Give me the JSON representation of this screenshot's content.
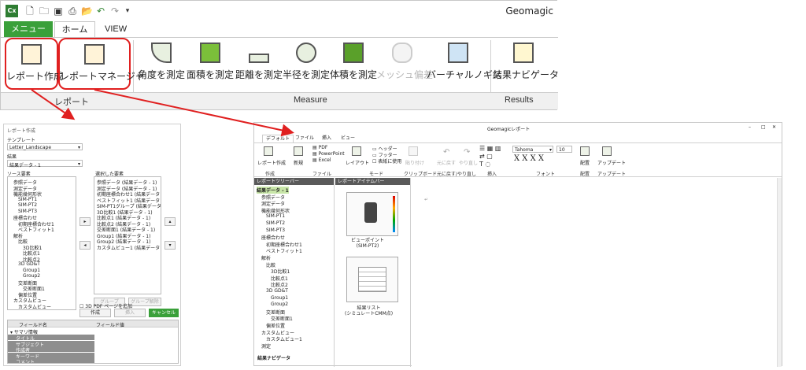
{
  "app": {
    "logo": "Cx",
    "title": "Geomagic",
    "quick_access_icons": [
      "new-icon",
      "open-icon",
      "save-icon",
      "print-icon",
      "folder-icon",
      "undo-icon",
      "redo-icon",
      "customize-icon"
    ]
  },
  "tabs": {
    "menu": "メニュー",
    "home": "ホーム",
    "view": "VIEW"
  },
  "ribbon": {
    "buttons": [
      {
        "label": "レポート作成",
        "icon": "report-create-icon"
      },
      {
        "label": "レポートマネージャ",
        "icon": "report-manager-icon"
      },
      {
        "label": "角度を測定",
        "icon": "angle-icon"
      },
      {
        "label": "面積を測定",
        "icon": "area-icon"
      },
      {
        "label": "距離を測定",
        "icon": "distance-icon"
      },
      {
        "label": "半径を測定",
        "icon": "radius-icon"
      },
      {
        "label": "体積を測定",
        "icon": "volume-icon"
      },
      {
        "label": "メッシュ偏差",
        "icon": "mesh-deviation-icon"
      },
      {
        "label": "バーチャルノギス",
        "icon": "caliper-icon"
      },
      {
        "label": "結果ナビゲータ",
        "icon": "result-navigator-icon"
      }
    ],
    "groups": {
      "report": "レポート",
      "measure": "Measure",
      "results": "Results"
    }
  },
  "left_panel": {
    "title": "レポート作成",
    "template_label": "テンプレート",
    "template_value": "Letter_Landscape",
    "result_label": "結果",
    "result_value": "結果データ - 1",
    "source_label": "ソース要素",
    "selected_label": "選択した要素",
    "source_items": [
      "参照データ",
      "測定データ",
      "機能幾何形状",
      "SIM-PT1",
      "SIM-PT2",
      "SIM-PT3",
      "座標合わせ",
      "初期座標合わせ1",
      "ベストフィット1",
      "解析",
      "比較",
      "3D比較1",
      "比較点1",
      "比較点2",
      "3D GD&T",
      "Group1",
      "Group2",
      "交差断面",
      "交差断面1",
      "偏差位置",
      "カスタムビュー",
      "カスタムビュー"
    ],
    "selected_items": [
      "参照データ (結果データ - 1)",
      "測定データ (結果データ - 1)",
      "初期座標合わせ1 (結果データ - 1)",
      "ベストフィット1 (結果データ - 1)",
      "SIM-PT1グループ (結果データ - 1)",
      "3D比較1 (結果データ - 1)",
      "比較点1 (結果データ - 1)",
      "比較点2 (結果データ - 1)",
      "交差断面1 (結果データ - 1)",
      "Group1 (結果データ - 1)",
      "Group2 (結果データ - 1)",
      "カスタムビュー1 (結果データ - 1)"
    ],
    "group_btn": "グループ",
    "ungroup_btn": "グループ解除",
    "pdf_check": "3D PDF ページを追加",
    "create_btn": "作成",
    "insert_btn": "挿入",
    "cancel_btn": "キャンセル",
    "field_name": "フィールド名",
    "field_value": "フィールド値",
    "sample_info": "サマリ情報",
    "fields": [
      "タイトル",
      "サブジェクト",
      "作成者",
      "キーワード",
      "コメント"
    ]
  },
  "report_window": {
    "title": "Geomagicレポート",
    "window_controls": [
      "–",
      "□",
      "✕"
    ],
    "tabs": [
      "デフォルト",
      "ファイル",
      "挿入",
      "ビュー"
    ],
    "buttons": {
      "create": "レポート作成",
      "new": "新規",
      "pdf": "PDF",
      "ppt": "PowerPoint",
      "excel": "Excel",
      "layout": "レイアウト",
      "header": "ヘッダー",
      "footer": "フッター",
      "table_use": "表紙に使用",
      "paste": "貼り付け",
      "undo": "元に戻す",
      "redo": "やり直し",
      "place": "配置",
      "update": "アップデート"
    },
    "font_name": "Tahoma",
    "font_size": "10",
    "font_styles": "X X X X",
    "groups": [
      "作成",
      "ファイル",
      "モード",
      "クリップボード",
      "元に戻す/やり直し",
      "挿入",
      "フォント",
      "配置",
      "アップデート"
    ],
    "tree_header": "レポートツリーバー",
    "items_header": "レポートアイテムバー",
    "tree_items": [
      "結果データ - 1",
      "参照データ",
      "測定データ",
      "機能幾何形状",
      "SIM-PT1",
      "SIM-PT2",
      "SIM-PT3",
      "座標合わせ",
      "初期座標合わせ1",
      "ベストフィット1",
      "解析",
      "比較",
      "3D比較1",
      "比較点1",
      "比較点2",
      "3D GD&T",
      "Group1",
      "Group2",
      "交差断面",
      "交差断面1",
      "偏差位置",
      "カスタムビュー",
      "カスタムビュー1",
      "測定"
    ],
    "tree_footer": "結果ナビゲータ",
    "thumb1": "ビューポイント\n(SIM-PT2)",
    "thumb2": "結果リスト\n(シミュレートCMM点)"
  }
}
